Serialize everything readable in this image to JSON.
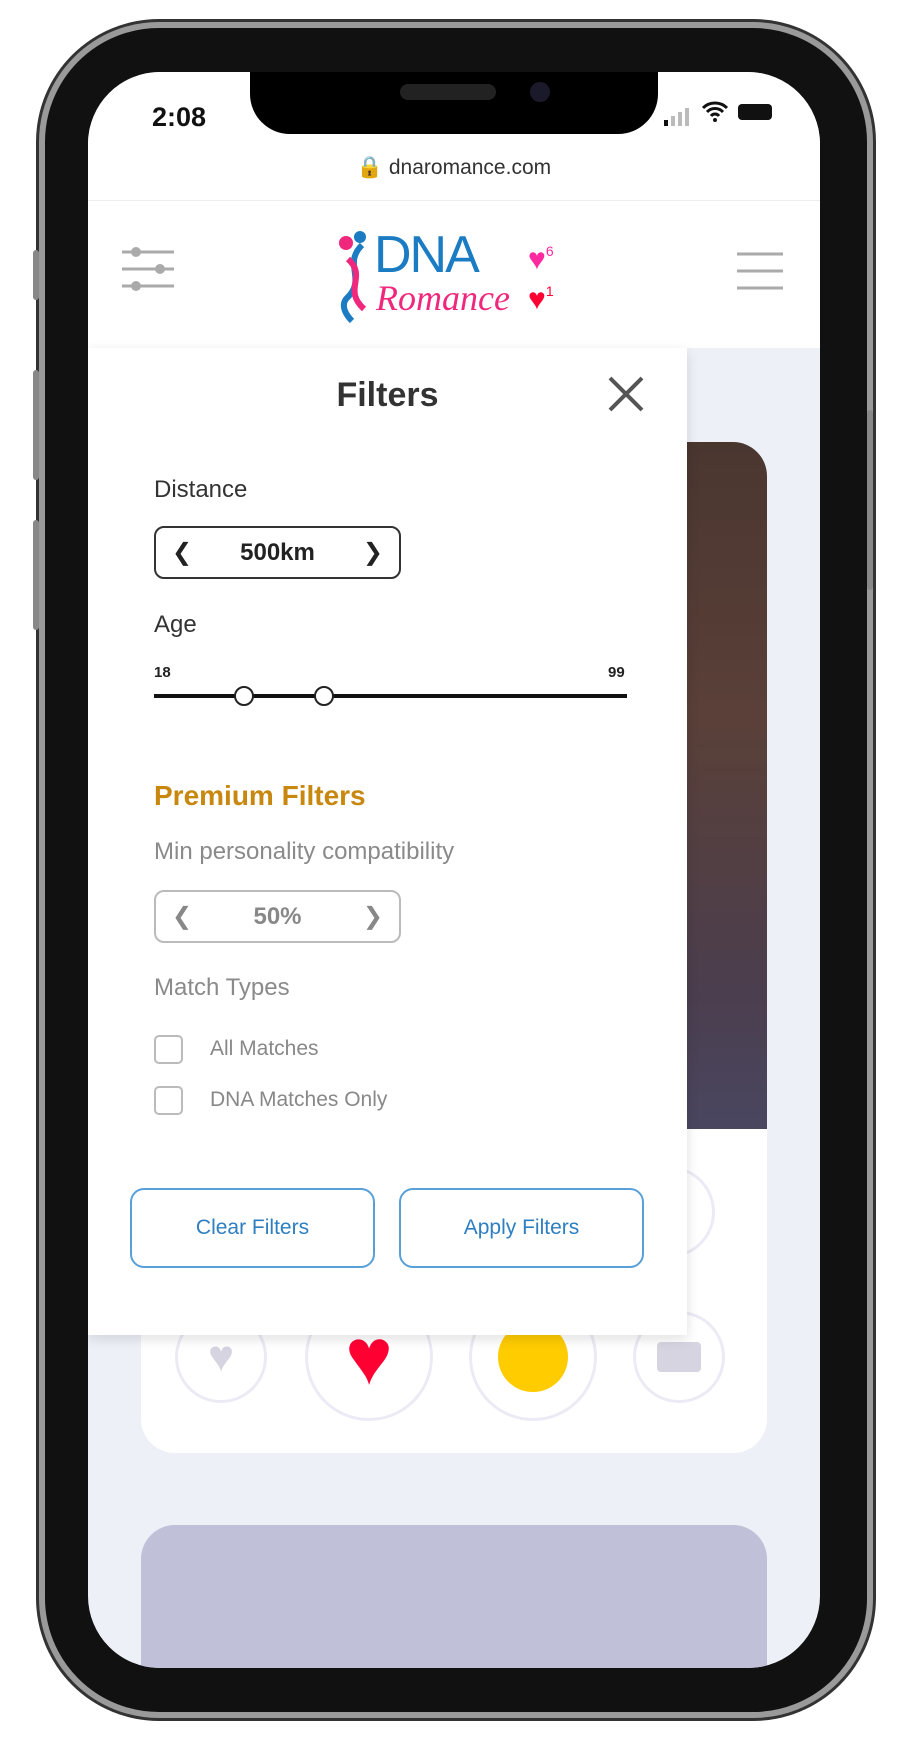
{
  "status_bar": {
    "time": "2:08"
  },
  "browser": {
    "url": "dnaromance.com"
  },
  "header": {
    "logo_top": "DNA",
    "logo_bottom": "Romance",
    "likes_count": "6",
    "matches_count": "1"
  },
  "filters": {
    "title": "Filters",
    "distance_label": "Distance",
    "distance_value": "500km",
    "age_label": "Age",
    "age_min": "18",
    "age_max": "99",
    "age_range_fraction": [
      0.19,
      0.36
    ],
    "premium_title": "Premium Filters",
    "compat_label": "Min personality compatibility",
    "compat_value": "50%",
    "match_types_label": "Match Types",
    "match_types": [
      {
        "label": "All Matches",
        "checked": false
      },
      {
        "label": "DNA Matches Only",
        "checked": false
      }
    ],
    "clear_label": "Clear Filters",
    "apply_label": "Apply Filters"
  },
  "colors": {
    "premium": "#c8870e",
    "accent": "#2d7fc1",
    "like": "#ff0033"
  }
}
